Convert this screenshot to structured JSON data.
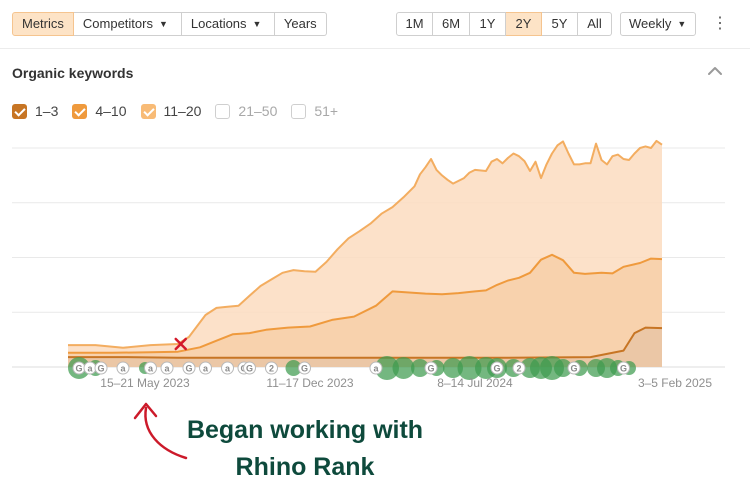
{
  "toolbar": {
    "left_tabs": [
      {
        "label": "Metrics",
        "active": true,
        "dropdown": false
      },
      {
        "label": "Competitors",
        "active": false,
        "dropdown": true
      },
      {
        "label": "Locations",
        "active": false,
        "dropdown": true
      },
      {
        "label": "Years",
        "active": false,
        "dropdown": false
      }
    ],
    "ranges": [
      {
        "label": "1M",
        "active": false
      },
      {
        "label": "6M",
        "active": false
      },
      {
        "label": "1Y",
        "active": false
      },
      {
        "label": "2Y",
        "active": true
      },
      {
        "label": "5Y",
        "active": false
      },
      {
        "label": "All",
        "active": false
      }
    ],
    "interval": "Weekly",
    "more_icon": "kebab-icon"
  },
  "panel": {
    "title": "Organic keywords",
    "collapse_icon": "chevron-up-icon"
  },
  "legend": [
    {
      "label": "1–3",
      "checked": true,
      "color": "#c77524"
    },
    {
      "label": "4–10",
      "checked": true,
      "color": "#ef9a3d"
    },
    {
      "label": "11–20",
      "checked": true,
      "color": "#f8bb76"
    },
    {
      "label": "21–50",
      "checked": false,
      "color": "#cccccc"
    },
    {
      "label": "51+",
      "checked": false,
      "color": "#cccccc"
    }
  ],
  "annotation": {
    "line1": "Began working with",
    "line2": "Rhino Rank",
    "color": "#0e4a3c",
    "arrow_color": "#cc1a2a",
    "marker": "x"
  },
  "chart_data": {
    "type": "area",
    "stacked": true,
    "grid": true,
    "x_ticks": [
      {
        "label": "15–21 May 2023",
        "week": 14
      },
      {
        "label": "11–17 Dec 2023",
        "week": 44
      },
      {
        "label": "8–14 Jul 2024",
        "week": 74
      },
      {
        "label": "3–5 Feb 2025",
        "week": 104
      }
    ],
    "x_range": [
      0,
      108
    ],
    "y_range": [
      0,
      4
    ],
    "y_grid": [
      1,
      2,
      3,
      4
    ],
    "series": [
      {
        "name": "1–3",
        "color": "#c77524",
        "fill": "#e9c6a4",
        "points": [
          [
            0,
            0.18
          ],
          [
            10,
            0.18
          ],
          [
            20,
            0.17
          ],
          [
            40,
            0.17
          ],
          [
            60,
            0.17
          ],
          [
            80,
            0.17
          ],
          [
            95,
            0.18
          ],
          [
            101,
            0.3
          ],
          [
            103,
            0.62
          ],
          [
            105,
            0.72
          ],
          [
            108,
            0.71
          ]
        ]
      },
      {
        "name": "4–10",
        "color": "#ef9a3d",
        "fill": "#f7cfa8",
        "points": [
          [
            0,
            0.26
          ],
          [
            8,
            0.26
          ],
          [
            15,
            0.27
          ],
          [
            20,
            0.28
          ],
          [
            24,
            0.36
          ],
          [
            27,
            0.48
          ],
          [
            30,
            0.6
          ],
          [
            33,
            0.62
          ],
          [
            36,
            0.68
          ],
          [
            40,
            0.72
          ],
          [
            44,
            0.74
          ],
          [
            48,
            0.86
          ],
          [
            52,
            0.92
          ],
          [
            56,
            1.12
          ],
          [
            59,
            1.38
          ],
          [
            62,
            1.36
          ],
          [
            65,
            1.34
          ],
          [
            68,
            1.33
          ],
          [
            71,
            1.35
          ],
          [
            74,
            1.38
          ],
          [
            76,
            1.4
          ],
          [
            78,
            1.5
          ],
          [
            80,
            1.58
          ],
          [
            82,
            1.63
          ],
          [
            84,
            1.72
          ],
          [
            86,
            1.96
          ],
          [
            88,
            2.05
          ],
          [
            90,
            1.95
          ],
          [
            92,
            1.72
          ],
          [
            94,
            1.7
          ],
          [
            97,
            1.72
          ],
          [
            99,
            1.71
          ],
          [
            101,
            1.83
          ],
          [
            104,
            1.9
          ],
          [
            106,
            1.98
          ],
          [
            108,
            1.97
          ]
        ]
      },
      {
        "name": "11–20",
        "color": "#f3ad60",
        "fill": "#fbdcc0",
        "points": [
          [
            0,
            0.4
          ],
          [
            5,
            0.4
          ],
          [
            10,
            0.35
          ],
          [
            15,
            0.4
          ],
          [
            20,
            0.42
          ],
          [
            22,
            0.55
          ],
          [
            25,
            0.95
          ],
          [
            27,
            1.08
          ],
          [
            29,
            1.1
          ],
          [
            31,
            1.12
          ],
          [
            33,
            1.3
          ],
          [
            35,
            1.48
          ],
          [
            37,
            1.6
          ],
          [
            39,
            1.72
          ],
          [
            41,
            1.77
          ],
          [
            43,
            1.75
          ],
          [
            45,
            1.74
          ],
          [
            47,
            1.92
          ],
          [
            49,
            2.15
          ],
          [
            51,
            2.35
          ],
          [
            53,
            2.48
          ],
          [
            55,
            2.62
          ],
          [
            57,
            2.8
          ],
          [
            59,
            2.92
          ],
          [
            61,
            3.1
          ],
          [
            63,
            3.3
          ],
          [
            64,
            3.52
          ],
          [
            65,
            3.65
          ],
          [
            66,
            3.8
          ],
          [
            67,
            3.6
          ],
          [
            68,
            3.5
          ],
          [
            69,
            3.42
          ],
          [
            70,
            3.35
          ],
          [
            72,
            3.45
          ],
          [
            73,
            3.55
          ],
          [
            74,
            3.6
          ],
          [
            76,
            3.58
          ],
          [
            77,
            3.75
          ],
          [
            78,
            3.8
          ],
          [
            79,
            3.72
          ],
          [
            80,
            3.82
          ],
          [
            81,
            3.9
          ],
          [
            82,
            3.85
          ],
          [
            83,
            3.76
          ],
          [
            84,
            3.58
          ],
          [
            85,
            3.75
          ],
          [
            86,
            3.45
          ],
          [
            87,
            3.7
          ],
          [
            88,
            3.9
          ],
          [
            89,
            4.05
          ],
          [
            90,
            4.12
          ],
          [
            91,
            3.9
          ],
          [
            92,
            3.7
          ],
          [
            93,
            3.7
          ],
          [
            94,
            3.72
          ],
          [
            95,
            3.72
          ],
          [
            96,
            4.08
          ],
          [
            97,
            3.78
          ],
          [
            98,
            3.7
          ],
          [
            99,
            3.85
          ],
          [
            100,
            3.88
          ],
          [
            101,
            3.8
          ],
          [
            102,
            3.78
          ],
          [
            103,
            3.9
          ],
          [
            104,
            4.0
          ],
          [
            105,
            4.03
          ],
          [
            106,
            4.0
          ],
          [
            107,
            4.13
          ],
          [
            108,
            4.06
          ]
        ]
      }
    ],
    "event_markers": [
      {
        "week": 2,
        "type": "google"
      },
      {
        "week": 4,
        "type": "a"
      },
      {
        "week": 6,
        "type": "google"
      },
      {
        "week": 10,
        "type": "a"
      },
      {
        "week": 15,
        "type": "a"
      },
      {
        "week": 18,
        "type": "a"
      },
      {
        "week": 22,
        "type": "google"
      },
      {
        "week": 25,
        "type": "a"
      },
      {
        "week": 29,
        "type": "a"
      },
      {
        "week": 32,
        "type": "google"
      },
      {
        "week": 33,
        "type": "google"
      },
      {
        "week": 37,
        "type": "two"
      },
      {
        "week": 43,
        "type": "google"
      },
      {
        "week": 56,
        "type": "a"
      },
      {
        "week": 66,
        "type": "google"
      },
      {
        "week": 78,
        "type": "google"
      },
      {
        "week": 82,
        "type": "two"
      },
      {
        "week": 92,
        "type": "google"
      },
      {
        "week": 101,
        "type": "google"
      }
    ],
    "green_blobs": [
      {
        "week": 2,
        "r": 11
      },
      {
        "week": 5,
        "r": 8
      },
      {
        "week": 14,
        "r": 6
      },
      {
        "week": 41,
        "r": 8
      },
      {
        "week": 58,
        "r": 12
      },
      {
        "week": 61,
        "r": 11
      },
      {
        "week": 64,
        "r": 9
      },
      {
        "week": 67,
        "r": 8
      },
      {
        "week": 70,
        "r": 10
      },
      {
        "week": 73,
        "r": 12
      },
      {
        "week": 76,
        "r": 11
      },
      {
        "week": 78,
        "r": 10
      },
      {
        "week": 81,
        "r": 9
      },
      {
        "week": 84,
        "r": 10
      },
      {
        "week": 86,
        "r": 11
      },
      {
        "week": 88,
        "r": 12
      },
      {
        "week": 90,
        "r": 9
      },
      {
        "week": 93,
        "r": 8
      },
      {
        "week": 96,
        "r": 9
      },
      {
        "week": 98,
        "r": 10
      },
      {
        "week": 100,
        "r": 8
      },
      {
        "week": 102,
        "r": 7
      }
    ]
  }
}
